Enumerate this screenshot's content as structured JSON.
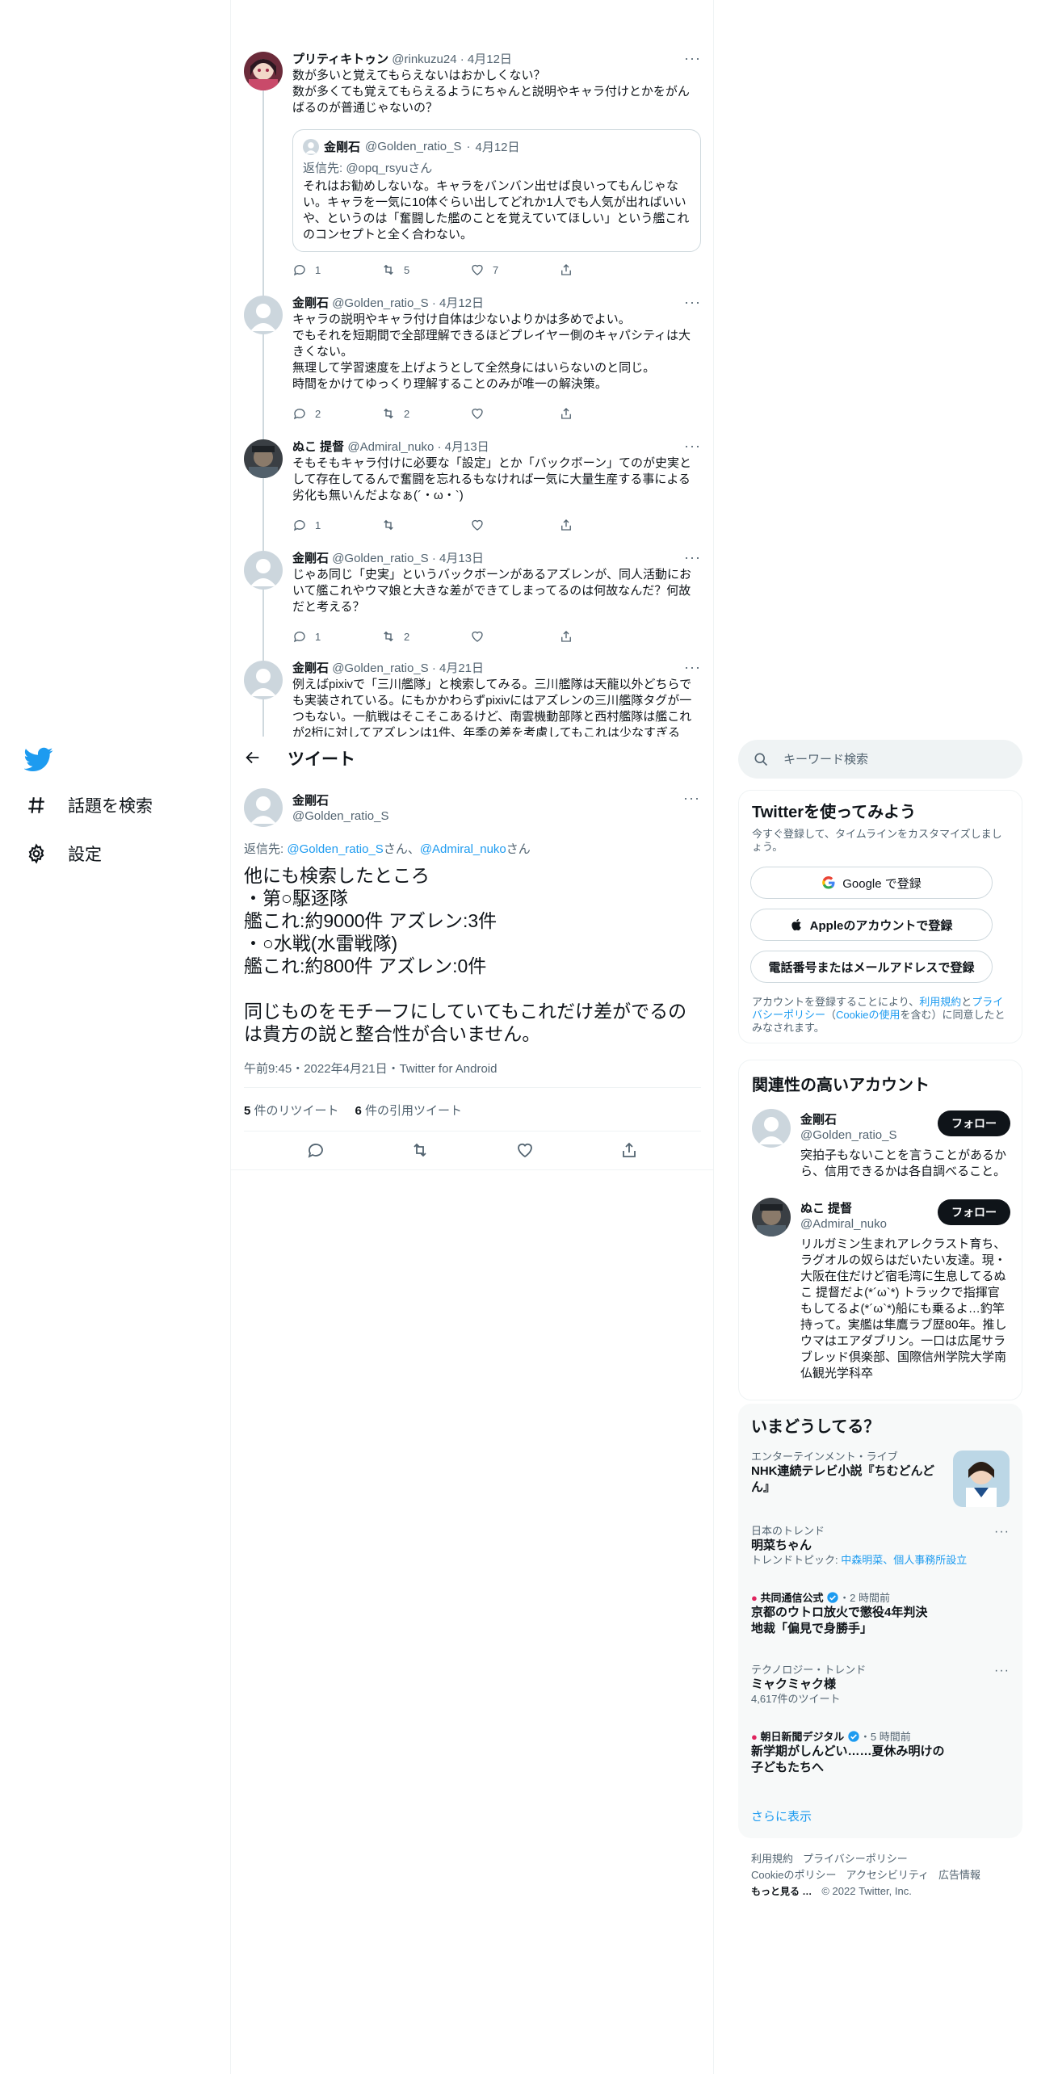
{
  "nav": {
    "items": [
      {
        "label": "話題を検索"
      },
      {
        "label": "設定"
      }
    ]
  },
  "thread": [
    {
      "name": "プリティキトゥン",
      "handle": "@rinkuzu24",
      "date": "4月12日",
      "text": "数が多いと覚えてもらえないはおかしくない？\n数が多くても覚えてもらえるようにちゃんと説明やキャラ付けとかをがんばるのが普通じゃないの？",
      "quote": {
        "name": "金剛石",
        "handle": "@Golden_ratio_S",
        "date": "4月12日",
        "reply": "返信先: @opq_rsyuさん",
        "text": "それはお勧めしないな。キャラをバンバン出せば良いってもんじゃない。キャラを一気に10体ぐらい出してどれか1人でも人気が出ればいいや、というのは「奮闘した艦のことを覚えていてほしい」という艦これのコンセプトと全く合わない。"
      },
      "stats": {
        "reply": "1",
        "retweet": "5",
        "like": "7"
      }
    },
    {
      "name": "金剛石",
      "handle": "@Golden_ratio_S",
      "date": "4月12日",
      "text": "キャラの説明やキャラ付け自体は少ないよりかは多めでよい。\nでもそれを短期間で全部理解できるほどプレイヤー側のキャパシティは大きくない。\n無理して学習速度を上げようとして全然身にはいらないのと同じ。\n時間をかけてゆっくり理解することのみが唯一の解決策。",
      "stats": {
        "reply": "2",
        "retweet": "2",
        "like": ""
      }
    },
    {
      "name": "ぬこ 提督",
      "handle": "@Admiral_nuko",
      "date": "4月13日",
      "text": "そもそもキャラ付けに必要な「設定」とか「バックボーン」てのが史実として存在してるんで奮闘を忘れるもなければ一気に大量生産する事による劣化も無いんだよなぁ(´・ω・`)",
      "stats": {
        "reply": "1",
        "retweet": "",
        "like": ""
      }
    },
    {
      "name": "金剛石",
      "handle": "@Golden_ratio_S",
      "date": "4月13日",
      "text": "じゃあ同じ「史実」というバックボーンがあるアズレンが、同人活動において艦これやウマ娘と大きな差ができてしまってるのは何故なんだ？何故だと考える？",
      "stats": {
        "reply": "1",
        "retweet": "2",
        "like": ""
      }
    },
    {
      "name": "金剛石",
      "handle": "@Golden_ratio_S",
      "date": "4月21日",
      "text": "例えばpixivで「三川艦隊」と検索してみる。三川艦隊は天龍以外どちらでも実装されている。にもかかわらずpixivにはアズレンの三川艦隊タグが一つもない。一航戦はそこそこあるけど、南雲機動部隊と西村艦隊は艦これが2桁に対してアズレンは1件、年季の差を考慮してもこれは少なすぎる"
    }
  ],
  "focus": {
    "header": "ツイート",
    "name": "金剛石",
    "handle": "@Golden_ratio_S",
    "reply_prefix": "返信先: ",
    "reply_user1": "@Golden_ratio_S",
    "reply_mid": "さん、",
    "reply_user2": "@Admiral_nuko",
    "reply_suffix": "さん",
    "text": "他にも検索したところ\n・第○駆逐隊\n艦これ:約9000件 アズレン:3件\n・○水戦(水雷戦隊)\n艦これ:約800件 アズレン:0件\n\n同じものをモチーフにしていてもこれだけ差がでるのは貴方の説と整合性が合いません。",
    "meta": "午前9:45・2022年4月21日・Twitter for Android",
    "retweets_count": "5",
    "retweets_label": "件のリツイート",
    "quotes_count": "6",
    "quotes_label": "件の引用ツイート"
  },
  "search": {
    "placeholder": "キーワード検索"
  },
  "signup": {
    "title": "Twitterを使ってみよう",
    "subtitle": "今すぐ登録して、タイムラインをカスタマイズしましょう。",
    "google": "Google で登録",
    "apple": "Appleのアカウントで登録",
    "phone": "電話番号またはメールアドレスで登録",
    "legal_1": "アカウントを登録することにより、",
    "legal_terms": "利用規約",
    "legal_2": "と",
    "legal_privacy": "プライバシーポリシー",
    "legal_3": "（",
    "legal_cookie": "Cookieの使用",
    "legal_4": "を含む）に同意したとみなされます。"
  },
  "related": {
    "title": "関連性の高いアカウント",
    "follow_label": "フォロー",
    "accounts": [
      {
        "name": "金剛石",
        "handle": "@Golden_ratio_S",
        "bio": "突拍子もないことを言うことがあるから、信用できるかは各自調べること。"
      },
      {
        "name": "ぬこ 提督",
        "handle": "@Admiral_nuko",
        "bio": "リルガミン生まれアレクラスト育ち、ラグオルの奴らはだいたい友達。現・大阪在住だけど宿毛湾に生息してるぬこ 提督だよ(*´ω`*) トラックで指揮官もしてるよ(*´ω`*)船にも乗るよ…釣竿持って。実艦は隼鷹ラブ歴80年。推しウマはエアダブリン。一口は広尾サラブレッド倶楽部、国際信州学院大学南仏観光学科卒"
      }
    ]
  },
  "trends": {
    "title": "いまどうしてる？",
    "items": [
      {
        "category": "エンターテインメント・ライブ",
        "title": "NHK連続テレビ小説『ちむどんどん』"
      },
      {
        "category": "日本のトレンド",
        "title": "明菜ちゃん",
        "meta_label": "トレンドトピック: ",
        "meta_link": "中森明菜、個人事務所設立"
      },
      {
        "source": "共同通信公式",
        "time": "・2 時間前",
        "title": "京都のウトロ放火で懲役4年判決　地裁「偏見で身勝手」"
      },
      {
        "category": "テクノロジー・トレンド",
        "title": "ミャクミャク様",
        "meta": "4,617件のツイート"
      },
      {
        "source": "朝日新聞デジタル",
        "time": "・5 時間前",
        "title": "新学期がしんどい……夏休み明けの子どもたちへ"
      }
    ],
    "show_more": "さらに表示"
  },
  "footer": {
    "terms": "利用規約",
    "privacy": "プライバシーポリシー",
    "cookie": "Cookieのポリシー",
    "accessibility": "アクセシビリティ",
    "ads": "広告情報",
    "more": "もっと見る …",
    "copyright": "© 2022 Twitter, Inc."
  },
  "colors": {
    "accent": "#1d9bf0",
    "text": "#0f1419",
    "muted": "#536471",
    "border": "#eff3f4"
  }
}
